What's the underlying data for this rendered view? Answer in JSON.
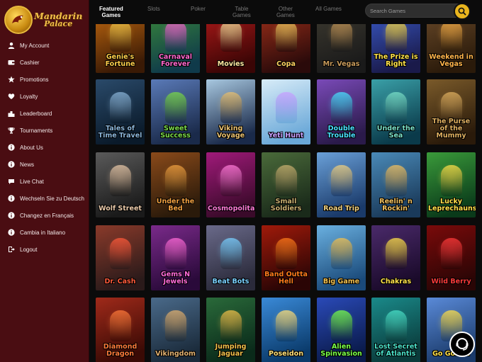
{
  "brand": {
    "name_line1": "Mandarin",
    "name_line2": "Palace"
  },
  "sidebar": {
    "items": [
      {
        "label": "My Account",
        "icon": "user-icon"
      },
      {
        "label": "Cashier",
        "icon": "wallet-icon"
      },
      {
        "label": "Promotions",
        "icon": "star-icon"
      },
      {
        "label": "Loyalty",
        "icon": "heart-icon"
      },
      {
        "label": "Leaderboard",
        "icon": "podium-icon"
      },
      {
        "label": "Tournaments",
        "icon": "trophy-icon"
      },
      {
        "label": "About Us",
        "icon": "info-icon"
      },
      {
        "label": "News",
        "icon": "info-icon"
      },
      {
        "label": "Live Chat",
        "icon": "chat-icon"
      },
      {
        "label": "Wechseln Sie zu Deutsch",
        "icon": "info-icon"
      },
      {
        "label": "Changez en Français",
        "icon": "info-icon"
      },
      {
        "label": "Cambia in Italiano",
        "icon": "info-icon"
      },
      {
        "label": "Logout",
        "icon": "logout-icon"
      }
    ]
  },
  "topnav": {
    "tabs": [
      {
        "line1": "Featured",
        "line2": "Games",
        "active": true
      },
      {
        "line1": "Slots",
        "line2": "",
        "active": false
      },
      {
        "line1": "Poker",
        "line2": "",
        "active": false
      },
      {
        "line1": "Table",
        "line2": "Games",
        "active": false
      },
      {
        "line1": "Other",
        "line2": "Games",
        "active": false
      },
      {
        "line1": "All Games",
        "line2": "",
        "active": false
      }
    ],
    "search_placeholder": "Search Games"
  },
  "colors": {
    "sidebar_bg": "#4a0d12",
    "accent_gold": "#e9b51e",
    "page_bg": "#0b0b0b"
  },
  "games": [
    [
      {
        "title": "Genie's Fortune",
        "bg": [
          "#3a1a05",
          "#c46a10"
        ],
        "glow": "#ffcf4a"
      },
      {
        "title": "Carnaval Forever",
        "bg": [
          "#0f3a4a",
          "#3a8a3a"
        ],
        "glow": "#ff6ad0"
      },
      {
        "title": "Movies",
        "bg": [
          "#3a0505",
          "#b21a1a"
        ],
        "glow": "#ffe7a0"
      },
      {
        "title": "Copa",
        "bg": [
          "#2a0a0a",
          "#a0301a"
        ],
        "glow": "#ffd060"
      },
      {
        "title": "Mr. Vegas",
        "bg": [
          "#1a1a1a",
          "#3d3a30"
        ],
        "glow": "#c89a5a"
      },
      {
        "title": "The Prize is Right",
        "bg": [
          "#1a1a4a",
          "#3a5ac8"
        ],
        "glow": "#ffe24a"
      },
      {
        "title": "Weekend in Vegas",
        "bg": [
          "#2a1a0a",
          "#6a4a2a"
        ],
        "glow": "#ffb44a"
      }
    ],
    [
      {
        "title": "Tales of Time Travel",
        "bg": [
          "#0a1a2a",
          "#2a4a6a"
        ],
        "glow": "#8ab4d8"
      },
      {
        "title": "Sweet Success",
        "bg": [
          "#1a2a4a",
          "#5a7ab8"
        ],
        "glow": "#7ad84a"
      },
      {
        "title": "Viking Voyage",
        "bg": [
          "#1a2a4a",
          "#a8c8e0"
        ],
        "glow": "#e8c070"
      },
      {
        "title": "Yeti Hunt",
        "bg": [
          "#6aa8d8",
          "#d8ecf8"
        ],
        "glow": "#c8a0ff"
      },
      {
        "title": "Double Trouble",
        "bg": [
          "#2a1a4a",
          "#7a4ab8"
        ],
        "glow": "#4ae0ff"
      },
      {
        "title": "Under the Sea",
        "bg": [
          "#0a3a4a",
          "#3aa0a8"
        ],
        "glow": "#7ae0c8"
      },
      {
        "title": "The Purse of the Mummy",
        "bg": [
          "#2a1a0a",
          "#7a5a2a"
        ],
        "glow": "#e0b060"
      }
    ],
    [
      {
        "title": "Wolf Street",
        "bg": [
          "#1a1a1a",
          "#5a5a5a"
        ],
        "glow": "#e8c8a8"
      },
      {
        "title": "Under the Bed",
        "bg": [
          "#2a1a0a",
          "#8a4a1a"
        ],
        "glow": "#f0a040"
      },
      {
        "title": "Cosmopolitan",
        "bg": [
          "#3a0a2a",
          "#a01a7a"
        ],
        "glow": "#ff7ad8"
      },
      {
        "title": "Small Soldiers",
        "bg": [
          "#1a2a1a",
          "#4a6a3a"
        ],
        "glow": "#c8b070"
      },
      {
        "title": "Road Trip",
        "bg": [
          "#1a3a6a",
          "#6aa0d8"
        ],
        "glow": "#f0d080"
      },
      {
        "title": "Reelin' n Rockin'",
        "bg": [
          "#1a3a5a",
          "#4a8ab8"
        ],
        "glow": "#f0c060"
      },
      {
        "title": "Lucky Leprechauns",
        "bg": [
          "#0a3a1a",
          "#3a9a3a"
        ],
        "glow": "#ffe04a"
      }
    ],
    [
      {
        "title": "Dr. Cash",
        "bg": [
          "#2a1a1a",
          "#8a3a2a"
        ],
        "glow": "#ff5a3a"
      },
      {
        "title": "Gems N Jewels",
        "bg": [
          "#2a0a3a",
          "#7a2a8a"
        ],
        "glow": "#ff6ad8"
      },
      {
        "title": "Beat Bots",
        "bg": [
          "#2a2a3a",
          "#6a6a8a"
        ],
        "glow": "#7ad0ff"
      },
      {
        "title": "Band Outta Hell",
        "bg": [
          "#2a0505",
          "#a01a0a"
        ],
        "glow": "#ff7a1a"
      },
      {
        "title": "Big Game",
        "bg": [
          "#1a4a7a",
          "#6ab0e0"
        ],
        "glow": "#f0c050"
      },
      {
        "title": "Chakras",
        "bg": [
          "#1a0a2a",
          "#4a2a6a"
        ],
        "glow": "#ffe04a"
      },
      {
        "title": "Wild Berry",
        "bg": [
          "#2a0505",
          "#7a0a0a"
        ],
        "glow": "#ff3a3a"
      }
    ],
    [
      {
        "title": "Diamond Dragon",
        "bg": [
          "#3a0a05",
          "#a02a1a"
        ],
        "glow": "#ff7a3a"
      },
      {
        "title": "Vikingdom",
        "bg": [
          "#1a2a3a",
          "#4a6a8a"
        ],
        "glow": "#e0b070"
      },
      {
        "title": "Jumping Jaguar",
        "bg": [
          "#0a2a1a",
          "#2a6a3a"
        ],
        "glow": "#f0c04a"
      },
      {
        "title": "Poseidon",
        "bg": [
          "#0a3a6a",
          "#3a8ad8"
        ],
        "glow": "#ffe07a"
      },
      {
        "title": "Alien Spinvasion",
        "bg": [
          "#0a1a4a",
          "#2a4ab8"
        ],
        "glow": "#7aff4a"
      },
      {
        "title": "Lost Secret of Atlantis",
        "bg": [
          "#0a3a3a",
          "#1a8a8a"
        ],
        "glow": "#4ae0c8"
      },
      {
        "title": "Go Gorilla",
        "bg": [
          "#1a3a6a",
          "#5a8ad8"
        ],
        "glow": "#ffe04a"
      }
    ]
  ]
}
